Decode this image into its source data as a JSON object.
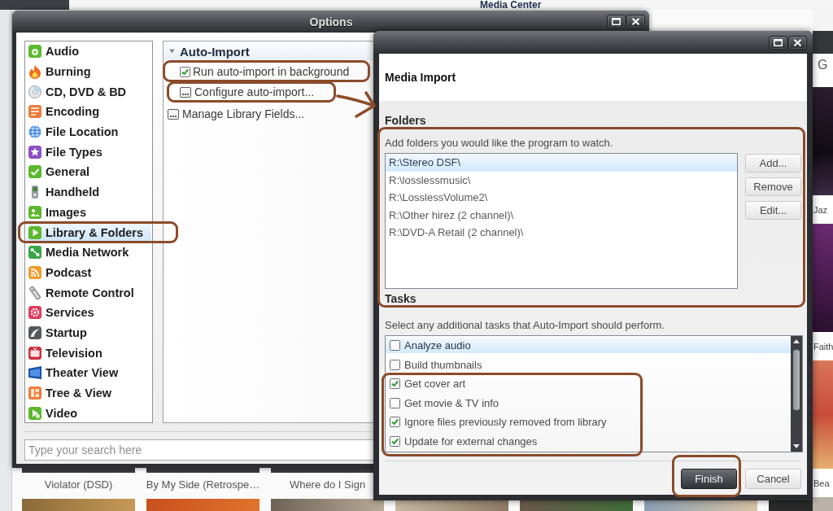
{
  "background_app": {
    "title": "Media Center",
    "header_text": "G",
    "albums": [
      {
        "title": "Violator (DSD)"
      },
      {
        "title": "By My Side (Retrospe…"
      },
      {
        "title": "Where do I Sign"
      }
    ],
    "side_albums": [
      {
        "title": "Jaz"
      },
      {
        "title": "Faith"
      },
      {
        "title": "Bea"
      }
    ]
  },
  "options_window": {
    "title": "Options",
    "categories": [
      {
        "label": "Audio",
        "selected": false
      },
      {
        "label": "Burning",
        "selected": false
      },
      {
        "label": "CD, DVD & BD",
        "selected": false
      },
      {
        "label": "Encoding",
        "selected": false
      },
      {
        "label": "File Location",
        "selected": false
      },
      {
        "label": "File Types",
        "selected": false
      },
      {
        "label": "General",
        "selected": false
      },
      {
        "label": "Handheld",
        "selected": false
      },
      {
        "label": "Images",
        "selected": false
      },
      {
        "label": "Library & Folders",
        "selected": true
      },
      {
        "label": "Media Network",
        "selected": false
      },
      {
        "label": "Podcast",
        "selected": false
      },
      {
        "label": "Remote Control",
        "selected": false
      },
      {
        "label": "Services",
        "selected": false
      },
      {
        "label": "Startup",
        "selected": false
      },
      {
        "label": "Television",
        "selected": false
      },
      {
        "label": "Theater View",
        "selected": false
      },
      {
        "label": "Tree & View",
        "selected": false
      },
      {
        "label": "Video",
        "selected": false
      }
    ],
    "panel": {
      "sections": [
        {
          "title": "Auto-Import",
          "expanded": true,
          "items": [
            {
              "kind": "checkbox",
              "label": "Run auto-import in background",
              "checked": true
            },
            {
              "kind": "action",
              "label": "Configure auto-import..."
            }
          ]
        }
      ],
      "items": [
        {
          "kind": "action",
          "label": "Manage Library Fields..."
        }
      ]
    },
    "search": {
      "placeholder": "Type your search here"
    }
  },
  "import_dialog": {
    "title": "Media Import",
    "folders": {
      "heading": "Folders",
      "hint": "Add folders you would like the program to watch.",
      "paths": [
        {
          "path": "R:\\Stereo DSF\\",
          "selected": true
        },
        {
          "path": "R:\\losslessmusic\\",
          "selected": false
        },
        {
          "path": "R:\\LosslessVolume2\\",
          "selected": false
        },
        {
          "path": "R:\\Other hirez (2 channel)\\",
          "selected": false
        },
        {
          "path": "R:\\DVD-A Retail (2 channel)\\",
          "selected": false
        }
      ],
      "buttons": [
        "Add...",
        "Remove",
        "Edit..."
      ]
    },
    "tasks": {
      "heading": "Tasks",
      "hint": "Select any additional tasks that Auto-Import should perform.",
      "items": [
        {
          "label": "Analyze audio",
          "checked": false,
          "selected": true
        },
        {
          "label": "Build thumbnails",
          "checked": false,
          "selected": false
        },
        {
          "label": "Get cover art",
          "checked": true,
          "selected": false
        },
        {
          "label": "Get movie & TV info",
          "checked": false,
          "selected": false
        },
        {
          "label": "Ignore files previously removed from library",
          "checked": true,
          "selected": false
        },
        {
          "label": "Update for external changes",
          "checked": true,
          "selected": false
        }
      ]
    },
    "buttons": [
      {
        "label": "Finish",
        "kind": "primary"
      },
      {
        "label": "Cancel",
        "kind": "secondary"
      }
    ]
  }
}
